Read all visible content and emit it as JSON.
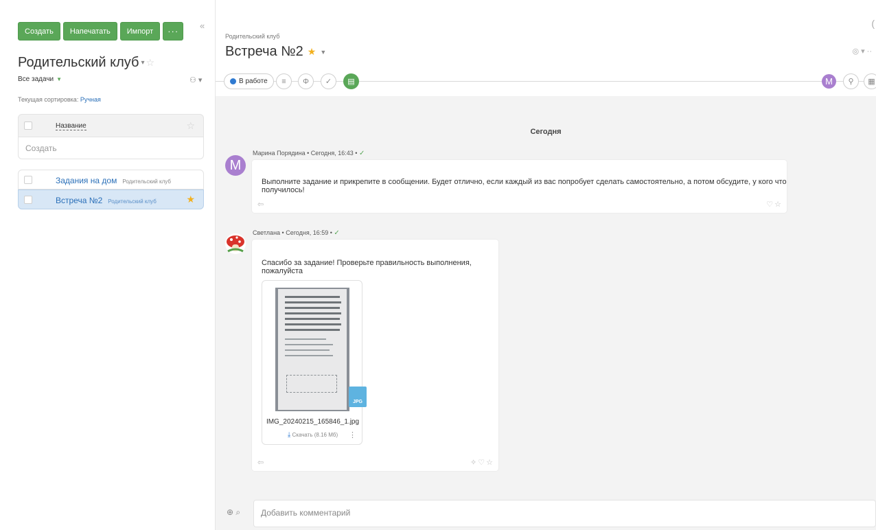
{
  "toolbar": {
    "create_label": "Создать",
    "print_label": "Напечатать",
    "import_label": "Импорт",
    "more_label": "···",
    "collapse_label": "«"
  },
  "project": {
    "title": "Родительский клуб",
    "filter_label": "Все задачи",
    "sort_prefix": "Текущая сортировка:",
    "sort_value": "Ручная"
  },
  "table": {
    "column_name": "Название",
    "create_placeholder": "Создать"
  },
  "tasks": [
    {
      "name": "Задания на дом",
      "project": "Родительский клуб",
      "starred": false
    },
    {
      "name": "Встреча №2",
      "project": "Родительский клуб",
      "starred": true
    }
  ],
  "task": {
    "breadcrumb": "Родительский клуб",
    "title": "Встреча №2",
    "status": "В работе"
  },
  "current_user_initial": "M",
  "feed": {
    "day_label": "Сегодня",
    "messages": [
      {
        "author": "Марина Порядина",
        "time": "Сегодня, 16:43",
        "text": "Выполните задание и прикрепите в сообщении. Будет отлично, если каждый из вас попробует сделать самостоятельно, а потом обсудите, у кого что получилось!",
        "avatar_initial": "M"
      },
      {
        "author": "Светлана",
        "time": "Сегодня, 16:59",
        "text": "Спасибо за задание! Проверьте правильность выполнения, пожалуйста",
        "attachment": {
          "file_name": "IMG_20240215_165846_1.jpg",
          "type_badge": "JPG",
          "download_label": "Скачать",
          "size": "(8.16 Мб)"
        }
      }
    ]
  },
  "composer": {
    "placeholder": "Добавить комментарий"
  },
  "colors": {
    "accent_green": "#5aa758",
    "link_blue": "#2a6fb8",
    "status_blue": "#2f7ad1",
    "star_yellow": "#f2b01e",
    "avatar_purple": "#a97fcf"
  }
}
